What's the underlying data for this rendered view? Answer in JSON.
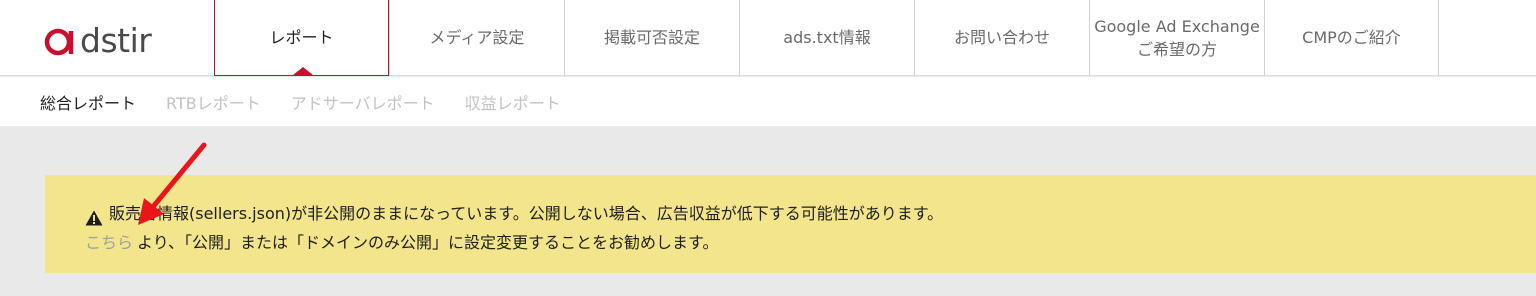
{
  "logo": {
    "text": "dstir",
    "alt_letter": "a"
  },
  "nav": {
    "items": [
      {
        "label": "レポート",
        "label2": ""
      },
      {
        "label": "メディア設定",
        "label2": ""
      },
      {
        "label": "掲載可否設定",
        "label2": ""
      },
      {
        "label": "ads.txt情報",
        "label2": ""
      },
      {
        "label": "お問い合わせ",
        "label2": ""
      },
      {
        "label": "Google Ad Exchange",
        "label2": "ご希望の方"
      },
      {
        "label": "CMPのご紹介",
        "label2": ""
      }
    ],
    "active_index": 0
  },
  "subnav": {
    "items": [
      {
        "label": "総合レポート"
      },
      {
        "label": "RTBレポート"
      },
      {
        "label": "アドサーバレポート"
      },
      {
        "label": "収益レポート"
      }
    ]
  },
  "alert": {
    "line1": "販売者情報(sellers.json)が非公開のままになっています。公開しない場合、広告収益が低下する可能性があります。",
    "link": "こちら",
    "line2_rest": "より、「公開」または「ドメインのみ公開」に設定変更することをお勧めします。"
  },
  "colors": {
    "brand_red": "#c8102e",
    "alert_bg": "#f2e58b",
    "page_bg": "#e9e9e9",
    "arrow": "#e8151b"
  }
}
